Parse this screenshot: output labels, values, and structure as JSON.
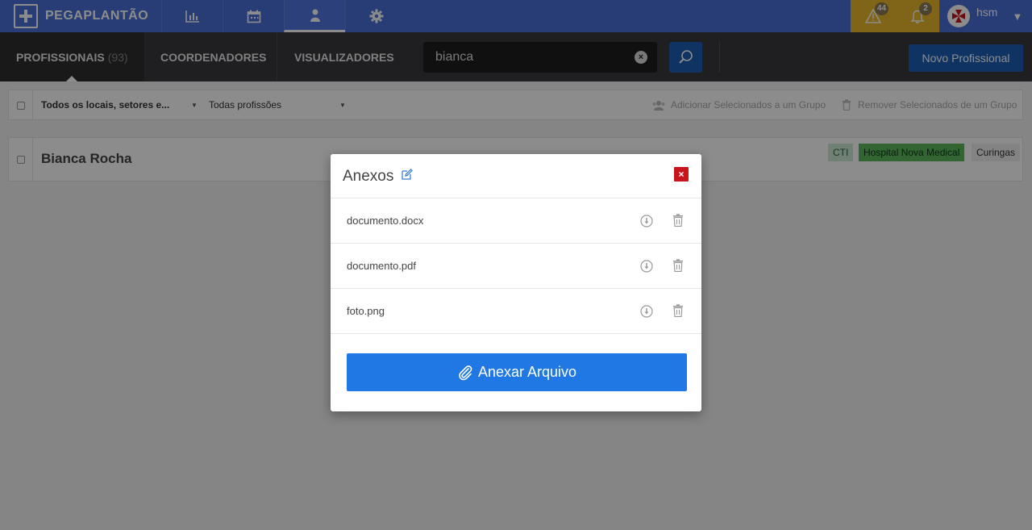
{
  "topbar": {
    "brand": "PEGAPLANTÃO",
    "nav": [
      {
        "icon": "bar-chart-icon"
      },
      {
        "icon": "calendar-icon"
      },
      {
        "icon": "person-icon"
      },
      {
        "icon": "gear-icon"
      }
    ],
    "alerts": [
      {
        "icon": "warning-icon",
        "count": "44"
      },
      {
        "icon": "bell-icon",
        "count": "2"
      }
    ],
    "user": {
      "name": "hsm"
    }
  },
  "subbar": {
    "tabs": [
      {
        "label": "PROFISSIONAIS",
        "count": "(93)"
      },
      {
        "label": "COORDENADORES"
      },
      {
        "label": "VISUALIZADORES"
      }
    ],
    "search": {
      "value": "bianca"
    },
    "new_button": "Novo Profissional"
  },
  "filters": {
    "locations": "Todos os locais, setores e...",
    "professions": "Todas profissões",
    "add_group": "Adicionar Selecionados a um Grupo",
    "remove_group": "Remover Selecionados de um Grupo"
  },
  "professional": {
    "name": "Bianca Rocha",
    "tags": [
      "CTI",
      "Hospital Nova Medical",
      "Curingas"
    ]
  },
  "modal": {
    "title": "Anexos",
    "files": [
      {
        "name": "documento.docx"
      },
      {
        "name": "documento.pdf"
      },
      {
        "name": "foto.png"
      }
    ],
    "attach_button": "Anexar Arquivo"
  },
  "colors": {
    "topbar": "#4a6fd8",
    "alerts": "#e9b82c",
    "primary": "#1f78e3",
    "close": "#c8151c",
    "tag_cti": "#cde9d4",
    "tag_hospital": "#5cb85c"
  }
}
